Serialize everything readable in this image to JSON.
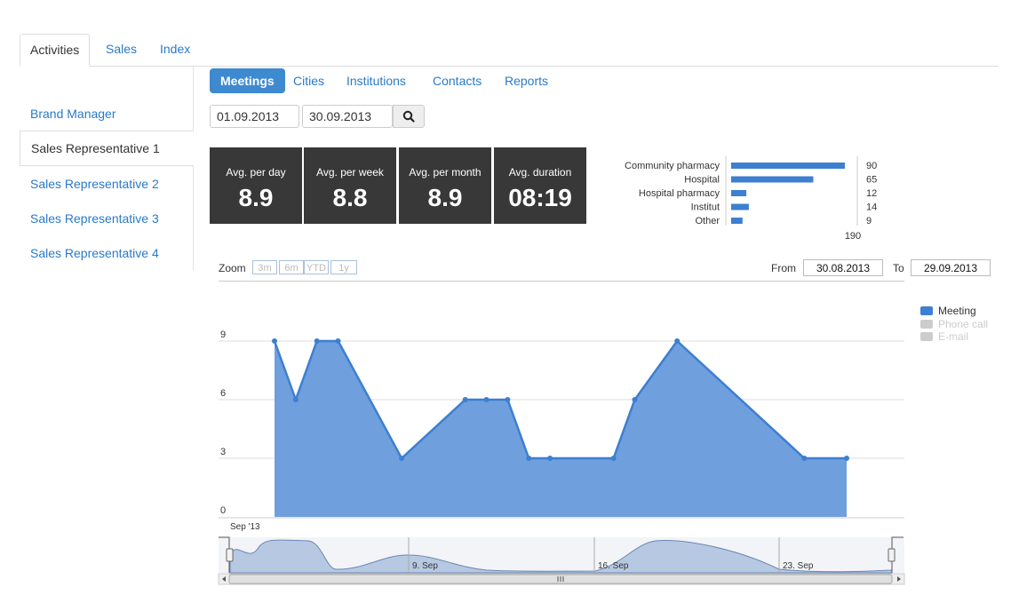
{
  "top_tabs": [
    "Activities",
    "Sales",
    "Index"
  ],
  "side_nav": [
    "Brand Manager",
    "Sales Representative 1",
    "Sales Representative 2",
    "Sales Representative 3",
    "Sales Representative 4"
  ],
  "sub_tabs": [
    "Meetings",
    "Cities",
    "Institutions",
    "Contacts",
    "Reports"
  ],
  "filter": {
    "from": "01.09.2013",
    "to": "30.09.2013"
  },
  "stats": [
    {
      "label": "Avg. per day",
      "value": "8.9"
    },
    {
      "label": "Avg. per week",
      "value": "8.8"
    },
    {
      "label": "Avg. per month",
      "value": "8.9"
    },
    {
      "label": "Avg. duration",
      "value": "08:19"
    }
  ],
  "zoom": {
    "label": "Zoom",
    "buttons": [
      "3m",
      "6m",
      "YTD",
      "1y"
    ],
    "from_label": "From",
    "from": "30.08.2013",
    "to_label": "To",
    "to": "29.09.2013"
  },
  "colors": {
    "accent": "#3e8ad1",
    "meeting": "#3d7fd0",
    "inactive": "#cccccc",
    "stat_bg": "#383838"
  },
  "chart_data": [
    {
      "type": "bar",
      "orientation": "horizontal",
      "categories": [
        "Community pharmacy",
        "Hospital",
        "Hospital pharmacy",
        "Institut",
        "Other"
      ],
      "values": [
        90,
        65,
        12,
        14,
        9
      ],
      "total": "190"
    },
    {
      "type": "area",
      "series": [
        {
          "name": "Meeting",
          "values": [
            9,
            6,
            9,
            9,
            3,
            6,
            6,
            6,
            3,
            3,
            3,
            6,
            9,
            3,
            3
          ]
        }
      ],
      "x": [
        "2013-09-03",
        "2013-09-04",
        "2013-09-05",
        "2013-09-06",
        "2013-09-09",
        "2013-09-12",
        "2013-09-13",
        "2013-09-14",
        "2013-09-15",
        "2013-09-16",
        "2013-09-19",
        "2013-09-20",
        "2013-09-22",
        "2013-09-28",
        "2013-09-30"
      ],
      "legend": [
        "Meeting",
        "Phone call",
        "E-mail"
      ],
      "y_ticks": [
        "0",
        "3",
        "6",
        "9"
      ],
      "ylim": [
        0,
        9
      ],
      "navigator_labels": [
        "Sep '13",
        "9. Sep",
        "16. Sep",
        "23. Sep"
      ]
    }
  ]
}
